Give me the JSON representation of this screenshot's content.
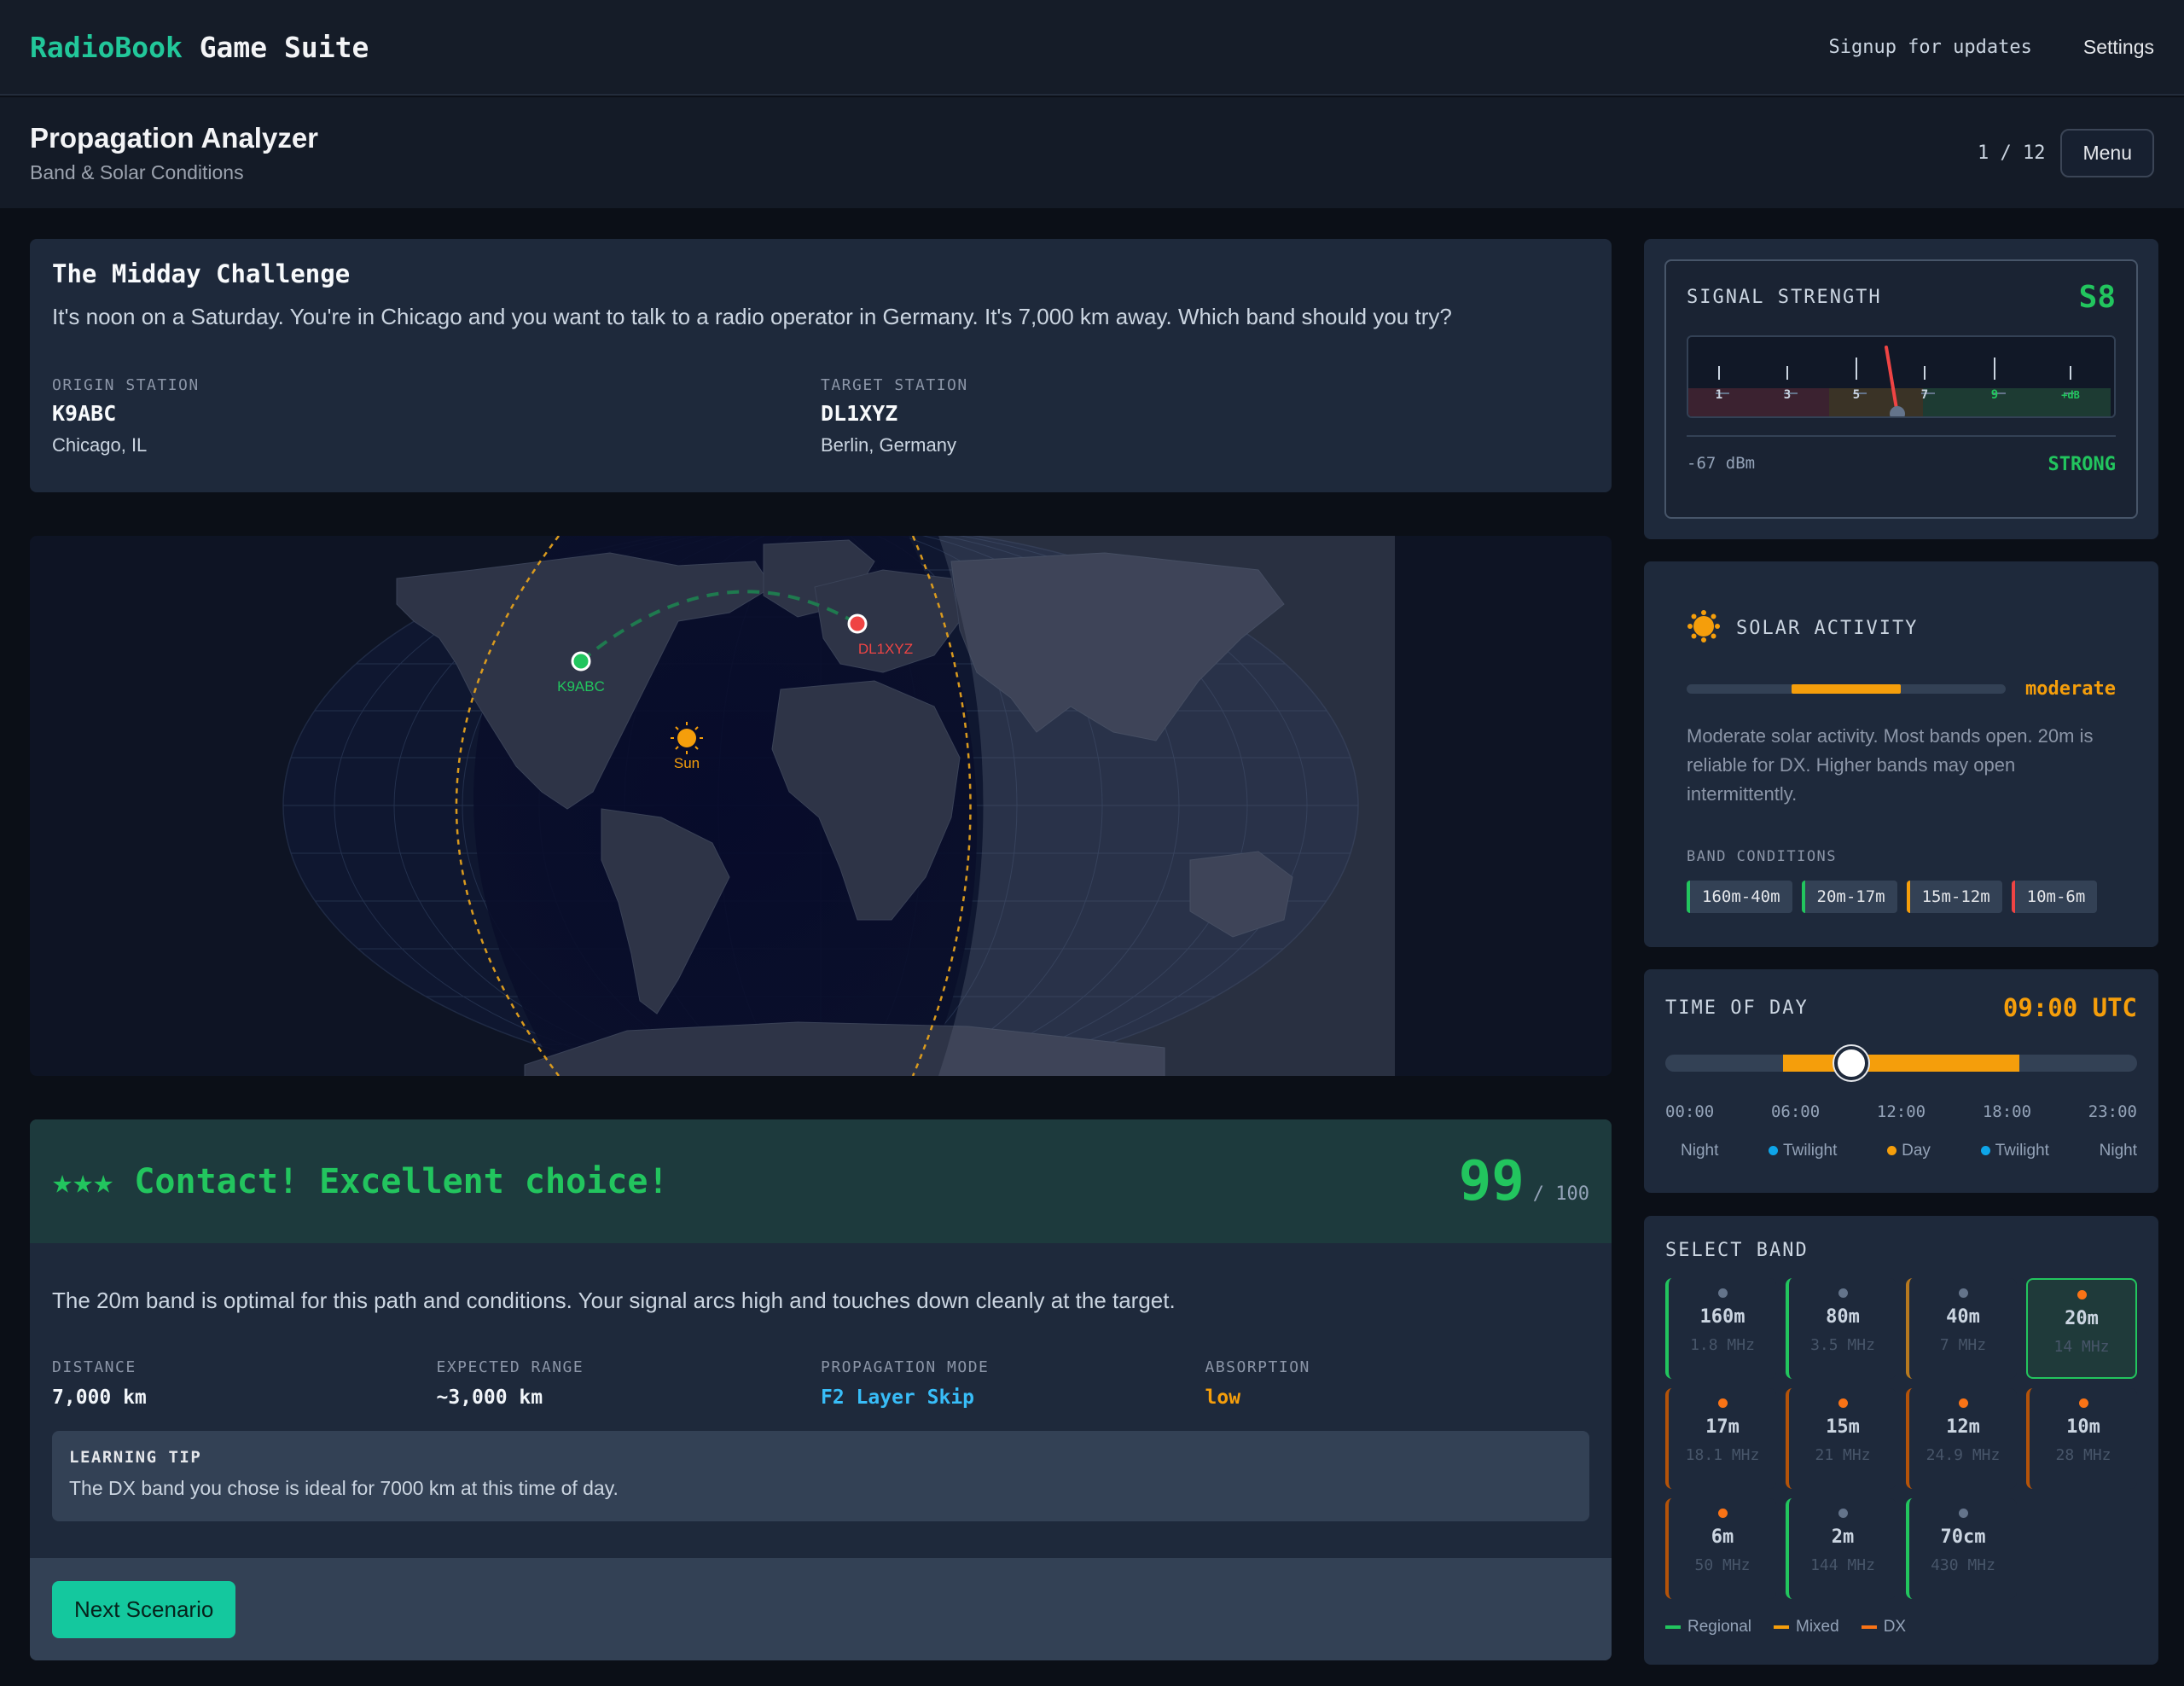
{
  "nav": {
    "brand_a": "RadioBook",
    "brand_b": "Game Suite",
    "signup": "Signup for updates",
    "settings": "Settings"
  },
  "header": {
    "title": "Propagation Analyzer",
    "subtitle": "Band & Solar Conditions",
    "pager": "1 / 12",
    "menu": "Menu"
  },
  "scenario": {
    "title": "The Midday Challenge",
    "question": "It's noon on a Saturday. You're in Chicago and you want to talk to a radio operator in Germany. It's 7,000 km away. Which band should you try?",
    "origin_label": "ORIGIN STATION",
    "origin_call": "K9ABC",
    "origin_loc": "Chicago, IL",
    "target_label": "TARGET STATION",
    "target_call": "DL1XYZ",
    "target_loc": "Berlin, Germany"
  },
  "map": {
    "origin_marker": "K9ABC",
    "target_marker": "DL1XYZ",
    "sun_label": "Sun"
  },
  "result": {
    "stars": "★★★",
    "title": "Contact! Excellent choice!",
    "score": "99",
    "score_max": "/ 100",
    "explanation": "The 20m band is optimal for this path and conditions. Your signal arcs high and touches down cleanly at the target.",
    "stats": [
      {
        "label": "DISTANCE",
        "value": "7,000 km",
        "color": "#f1f5f9"
      },
      {
        "label": "EXPECTED RANGE",
        "value": "~3,000 km",
        "color": "#f1f5f9"
      },
      {
        "label": "PROPAGATION MODE",
        "value": "F2 Layer Skip",
        "color": "#38bdf8"
      },
      {
        "label": "ABSORPTION",
        "value": "low",
        "color": "#f59e0b"
      }
    ],
    "tip_title": "LEARNING TIP",
    "tip": "The DX band you chose is ideal for 7000 km at this time of day.",
    "next": "Next Scenario"
  },
  "signal": {
    "label": "SIGNAL STRENGTH",
    "reading": "S8",
    "scale": [
      "1",
      "3",
      "5",
      "7",
      "9",
      "+dB"
    ],
    "dbm": "-67 dBm",
    "status": "STRONG",
    "needle_level": 0.49
  },
  "solar": {
    "label": "SOLAR ACTIVITY",
    "level": "moderate",
    "level_fraction_start": 0.33,
    "level_fraction_end": 0.67,
    "description": "Moderate solar activity. Most bands open. 20m is reliable for DX. Higher bands may open intermittently.",
    "band_conditions_label": "BAND CONDITIONS",
    "band_conditions": [
      {
        "label": "160m-40m",
        "color": "#22c55e"
      },
      {
        "label": "20m-17m",
        "color": "#22c55e"
      },
      {
        "label": "15m-12m",
        "color": "#f59e0b"
      },
      {
        "label": "10m-6m",
        "color": "#ef4444"
      }
    ]
  },
  "time_of_day": {
    "label": "TIME OF DAY",
    "value": "09:00 UTC",
    "ticks": [
      "00:00",
      "06:00",
      "12:00",
      "18:00",
      "23:00"
    ],
    "periods": [
      {
        "label": "Night",
        "dot": ""
      },
      {
        "label": "Twilight",
        "dot": "#0ea5e9"
      },
      {
        "label": "Day",
        "dot": "#f59e0b"
      },
      {
        "label": "Twilight",
        "dot": "#0ea5e9"
      },
      {
        "label": "Night",
        "dot": ""
      }
    ]
  },
  "bands": {
    "label": "SELECT BAND",
    "items": [
      {
        "name": "160m",
        "freq": "1.8 MHz",
        "type": "regional",
        "selected": false
      },
      {
        "name": "80m",
        "freq": "3.5 MHz",
        "type": "regional",
        "selected": false
      },
      {
        "name": "40m",
        "freq": "7 MHz",
        "type": "mixed",
        "selected": false
      },
      {
        "name": "20m",
        "freq": "14 MHz",
        "type": "dx",
        "selected": true
      },
      {
        "name": "17m",
        "freq": "18.1 MHz",
        "type": "dx",
        "selected": false
      },
      {
        "name": "15m",
        "freq": "21 MHz",
        "type": "dx",
        "selected": false
      },
      {
        "name": "12m",
        "freq": "24.9 MHz",
        "type": "dx",
        "selected": false
      },
      {
        "name": "10m",
        "freq": "28 MHz",
        "type": "dx",
        "selected": false
      },
      {
        "name": "6m",
        "freq": "50 MHz",
        "type": "dx",
        "selected": false
      },
      {
        "name": "2m",
        "freq": "144 MHz",
        "type": "regional",
        "selected": false
      },
      {
        "name": "70cm",
        "freq": "430 MHz",
        "type": "regional",
        "selected": false
      }
    ],
    "legend": [
      {
        "label": "Regional",
        "color": "#22c55e"
      },
      {
        "label": "Mixed",
        "color": "#f59e0b"
      },
      {
        "label": "DX",
        "color": "#f97316"
      }
    ]
  }
}
